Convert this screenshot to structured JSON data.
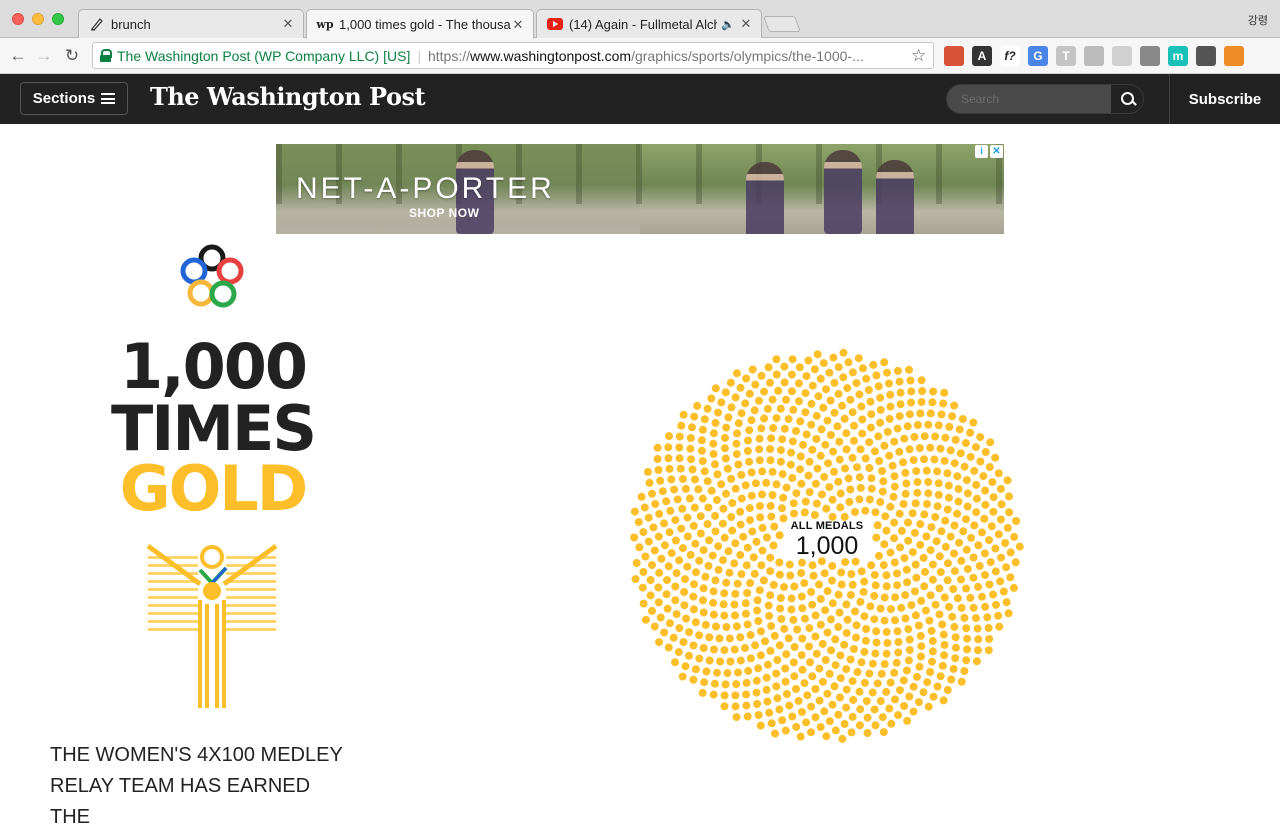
{
  "browser": {
    "tabs": [
      {
        "label": "brunch",
        "icon": "pen-icon",
        "active": false
      },
      {
        "label": "1,000 times gold - The thousan",
        "icon": "wp-icon",
        "active": true
      },
      {
        "label": "(14) Again - Fullmetal Alche",
        "icon": "youtube-icon",
        "active": false,
        "audio": "🔈"
      }
    ],
    "profile_name": "강령",
    "security_label": "The Washington Post (WP Company LLC) [US]",
    "url": {
      "scheme": "https://",
      "host": "www.washingtonpost.com",
      "path": "/graphics/sports/olympics/the-1000-..."
    },
    "extensions": [
      {
        "name": "bookmark-ext-icon",
        "color": "#d9533a",
        "glyph": ""
      },
      {
        "name": "font-ext-icon",
        "color": "#333333",
        "glyph": "A"
      },
      {
        "name": "whatfont-ext-icon",
        "color": "#ffffff",
        "glyph": "f?"
      },
      {
        "name": "translate-ext-icon",
        "color": "#4a86e8",
        "glyph": "G"
      },
      {
        "name": "text-ext-icon",
        "color": "#c4c4c4",
        "glyph": "T"
      },
      {
        "name": "globe-ext-icon",
        "color": "#bbbbbb",
        "glyph": ""
      },
      {
        "name": "page-ext-icon",
        "color": "#d0d0d0",
        "glyph": ""
      },
      {
        "name": "eyedropper-ext-icon",
        "color": "#888888",
        "glyph": ""
      },
      {
        "name": "circle-ext-icon",
        "color": "#19c0b7",
        "glyph": "m"
      },
      {
        "name": "evernote-ext-icon",
        "color": "#555555",
        "glyph": ""
      },
      {
        "name": "chart-ext-icon",
        "color": "#f08a24",
        "glyph": ""
      }
    ]
  },
  "header": {
    "sections_label": "Sections",
    "masthead": "The Washington Post",
    "search_placeholder": "Search",
    "subscribe_label": "Subscribe"
  },
  "ad": {
    "brand": "NET-A-PORTER",
    "cta": "SHOP NOW"
  },
  "article": {
    "headline_line1": "1,000",
    "headline_line2": "TIMES",
    "headline_line3": "GOLD",
    "caption": "THE WOMEN'S 4X100 MEDLEY RELAY TEAM HAS EARNED THE",
    "colors": {
      "gold": "#fcbf2a",
      "ink": "#222222"
    }
  },
  "cluster": {
    "label": "ALL MEDALS",
    "count_text": "1,000",
    "dot_count": 1000,
    "dot_color": "#fcbf2a"
  }
}
